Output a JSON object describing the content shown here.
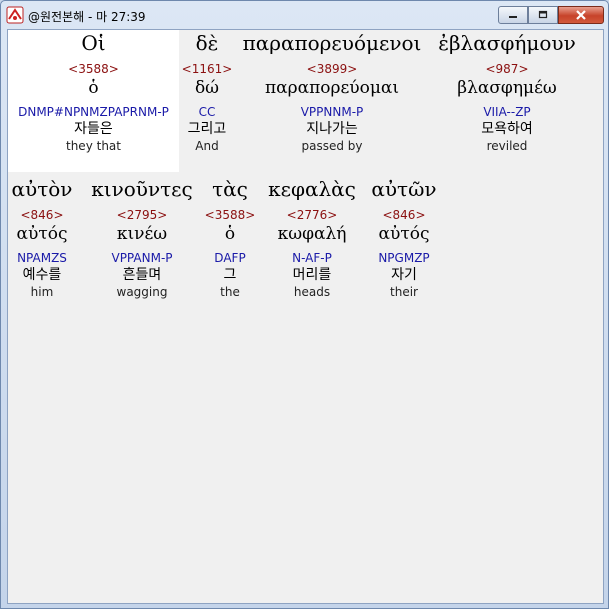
{
  "window": {
    "title": "@원전본해 - 마 27:39",
    "minimize_label": "minimize",
    "maximize_label": "maximize",
    "close_label": "close"
  },
  "rows": [
    [
      {
        "greek": "Οἱ",
        "strong": "<3588>",
        "lemma": "ὁ",
        "morph": "DNMP#NPNMZPAPRNM-P",
        "korean": "자들은",
        "english": "they that"
      },
      {
        "greek": "δὲ",
        "strong": "<1161>",
        "lemma": "δώ",
        "morph": "CC",
        "korean": "그리고",
        "english": "And"
      },
      {
        "greek": "παραπορευόμενοι",
        "strong": "<3899>",
        "lemma": "παραπορεύομαι",
        "morph": "VPPNNM-P",
        "korean": "지나가는",
        "english": "passed by"
      },
      {
        "greek": "ἐβλασφήμουν",
        "strong": "<987>",
        "lemma": "βλασφημέω",
        "morph": "VIIA--ZP",
        "korean": "모욕하여",
        "english": "reviled"
      }
    ],
    [
      {
        "greek": "αὐτὸν",
        "strong": "<846>",
        "lemma": "αὐτός",
        "morph": "NPAMZS",
        "korean": "예수를",
        "english": "him"
      },
      {
        "greek": "κινοῦντες",
        "strong": "<2795>",
        "lemma": "κινέω",
        "morph": "VPPANM-P",
        "korean": "흔들며",
        "english": "wagging"
      },
      {
        "greek": "τὰς",
        "strong": "<3588>",
        "lemma": "ὁ",
        "morph": "DAFP",
        "korean": "그",
        "english": "the"
      },
      {
        "greek": "κεφαλὰς",
        "strong": "<2776>",
        "lemma": "κωφαλή",
        "morph": "N-AF-P",
        "korean": "머리를",
        "english": "heads"
      },
      {
        "greek": "αὐτῶν",
        "strong": "<846>",
        "lemma": "αὐτός",
        "morph": "NPGMZP",
        "korean": "자기",
        "english": "their"
      }
    ]
  ]
}
